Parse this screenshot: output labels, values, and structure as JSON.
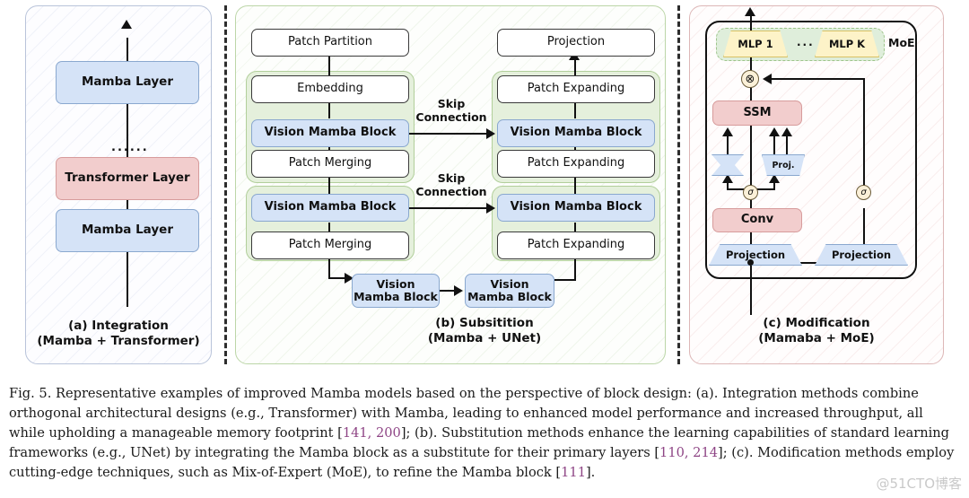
{
  "figure": {
    "panel_a": {
      "nodes": [
        {
          "label": "Mamba Layer",
          "kind": "blue"
        },
        {
          "label": "Transformer Layer",
          "kind": "pink"
        },
        {
          "label": "Mamba Layer",
          "kind": "blue"
        }
      ],
      "ellipsis": "......",
      "caption_line1": "(a) Integration",
      "caption_line2": "(Mamba + Transformer)"
    },
    "panel_b": {
      "encoder": {
        "top": "Patch Partition",
        "stage1": [
          "Embedding",
          "Vision Mamba Block",
          "Patch Merging"
        ],
        "stage2": [
          "Vision Mamba Block",
          "Patch Merging"
        ]
      },
      "decoder": {
        "top": "Projection",
        "stage1": [
          "Patch Expanding",
          "Vision Mamba Block",
          "Patch Expanding"
        ],
        "stage2": [
          "Vision Mamba Block",
          "Patch Expanding"
        ]
      },
      "bottleneck": [
        "Vision Mamba Block",
        "Vision Mamba Block"
      ],
      "skip_labels": [
        {
          "line1": "Skip",
          "line2": "Connection"
        },
        {
          "line1": "Skip",
          "line2": "Connection"
        }
      ],
      "caption_line1": "(b) Subsitition",
      "caption_line2": "(Mamba + UNet)"
    },
    "panel_c": {
      "moe": {
        "experts": [
          "MLP 1",
          "MLP K"
        ],
        "ellipsis": "...",
        "label": "MoE"
      },
      "mult_symbol": "⊗",
      "ssm": "SSM",
      "conv": "Conv",
      "proj_small": "Proj.",
      "projection_left": "Projection",
      "projection_right": "Projection",
      "sigma": "σ",
      "caption_line1": "(c) Modification",
      "caption_line2": "(Mamaba + MoE)"
    }
  },
  "caption": {
    "label": "Fig. 5.",
    "text_parts": [
      {
        "t": "  Representative examples of improved Mamba models based on the perspective of block design: (a). Integration methods combine orthogonal architectural designs (e.g., Transformer) with Mamba, leading to enhanced model performance and increased throughput, all while upholding a manageable memory footprint [",
        "cite": false
      },
      {
        "t": "141, 200",
        "cite": true
      },
      {
        "t": "]; (b). Substitution methods enhance the learning capabilities of standard learning frameworks (e.g., UNet) by integrating the Mamba block as a substitute for their primary layers [",
        "cite": false
      },
      {
        "t": "110, 214",
        "cite": true
      },
      {
        "t": "]; (c). Modification methods employ cutting-edge techniques, such as Mix-of-Expert (MoE), to refine the Mamba block [",
        "cite": false
      },
      {
        "t": "111",
        "cite": true
      },
      {
        "t": "].",
        "cite": false
      }
    ]
  },
  "watermark": "@51CTO博客",
  "colors": {
    "blue_fill": "#d5e3f7",
    "blue_border": "#8aa8cf",
    "pink_fill": "#f2cdcd",
    "pink_border": "#d79c9c",
    "green_group": "#e5f0dc",
    "green_border": "#b2cf9b",
    "yellow_fill": "#fdf3c8",
    "cite_purple": "#8e4585"
  }
}
